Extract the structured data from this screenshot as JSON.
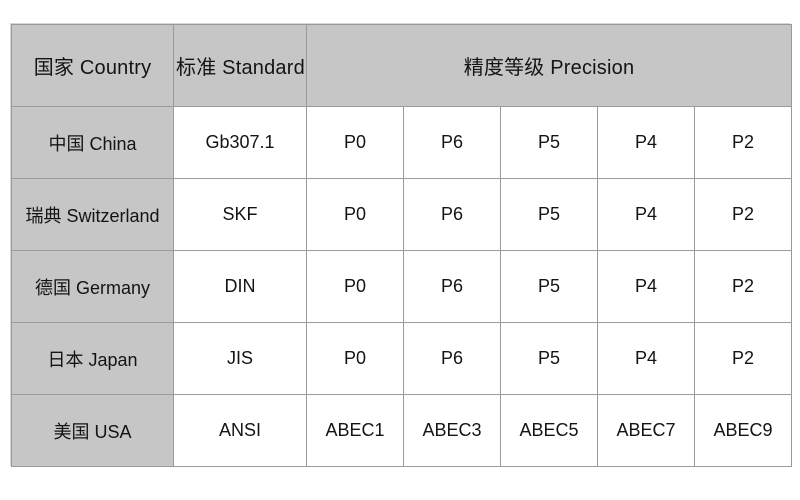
{
  "table": {
    "headers": {
      "country": "国家 Country",
      "standard": "标准 Standard",
      "precision": "精度等级 Precision"
    },
    "precision_column_count": 5,
    "colors": {
      "header_background": "#c6c6c6",
      "country_cell_background": "#c6c6c6",
      "data_cell_background": "#ffffff",
      "grid_line": "#9a9a9a",
      "outer_border": "#d6d6d6",
      "text": "#141414"
    },
    "rows": [
      {
        "country": "中国 China",
        "standard": "Gb307.1",
        "grades": [
          "P0",
          "P6",
          "P5",
          "P4",
          "P2"
        ]
      },
      {
        "country": "瑞典 Switzerland",
        "standard": "SKF",
        "grades": [
          "P0",
          "P6",
          "P5",
          "P4",
          "P2"
        ]
      },
      {
        "country": "德国 Germany",
        "standard": "DIN",
        "grades": [
          "P0",
          "P6",
          "P5",
          "P4",
          "P2"
        ]
      },
      {
        "country": "日本 Japan",
        "standard": "JIS",
        "grades": [
          "P0",
          "P6",
          "P5",
          "P4",
          "P2"
        ]
      },
      {
        "country": "美国 USA",
        "standard": "ANSI",
        "grades": [
          "ABEC1",
          "ABEC3",
          "ABEC5",
          "ABEC7",
          "ABEC9"
        ]
      }
    ]
  }
}
